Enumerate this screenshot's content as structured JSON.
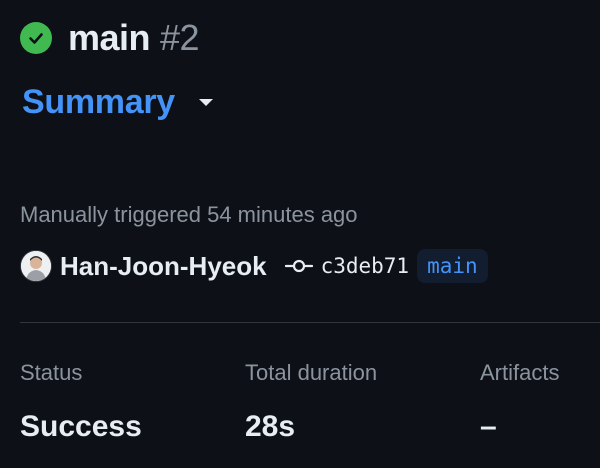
{
  "run": {
    "workflow_name": "main",
    "run_number": "#2",
    "status": "success"
  },
  "nav": {
    "summary_label": "Summary"
  },
  "trigger": {
    "text": "Manually triggered 54 minutes ago"
  },
  "actor": {
    "username": "Han-Joon-Hyeok",
    "commit_sha": "c3deb71",
    "branch": "main"
  },
  "stats": {
    "status_label": "Status",
    "status_value": "Success",
    "duration_label": "Total duration",
    "duration_value": "28s",
    "artifacts_label": "Artifacts",
    "artifacts_value": "–"
  },
  "colors": {
    "background": "#0d1117",
    "success": "#3fb950",
    "link": "#4493f8",
    "muted": "#8b949e",
    "text": "#e6edf3"
  },
  "icons": {
    "status": "check-circle-icon",
    "dropdown": "triangle-down-icon",
    "commit": "git-commit-icon"
  }
}
